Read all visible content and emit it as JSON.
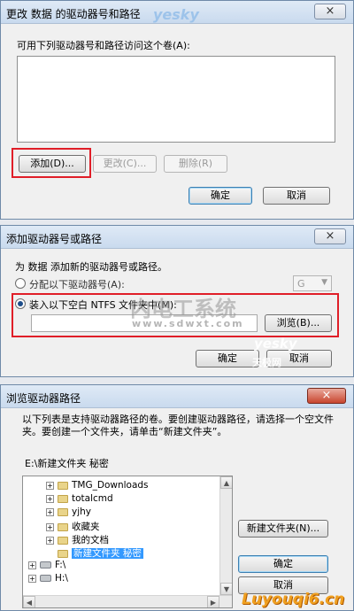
{
  "dialog1": {
    "title": "更改 数据 的驱动器号和路径",
    "close": "×",
    "list_label": "可用下列驱动器号和路径访问这个卷(A):",
    "add_button": "添加(D)...",
    "change_button": "更改(C)...",
    "delete_button": "删除(R)",
    "ok_button": "确定",
    "cancel_button": "取消"
  },
  "dialog2": {
    "title": "添加驱动器号或路径",
    "close": "×",
    "intro": "为 数据 添加新的驱动器号或路径。",
    "radio_letter_label": "分配以下驱动器号(A):",
    "letter_value": "G",
    "radio_folder_label": "装入以下空白 NTFS 文件夹中(M):",
    "folder_value": "",
    "browse_button": "浏览(B)...",
    "ok_button": "确定",
    "cancel_button": "取消"
  },
  "dialog3": {
    "title": "浏览驱动器路径",
    "close": "×",
    "description": "以下列表是支持驱动器路径的卷。要创建驱动器路径，请选择一个空文件夹。要创建一个文件夹，请单击“新建文件夹”。",
    "path_value": "E:\\新建文件夹 秘密",
    "tree": [
      {
        "label": "TMG_Downloads",
        "type": "folder",
        "expander": "+"
      },
      {
        "label": "totalcmd",
        "type": "folder",
        "expander": "+"
      },
      {
        "label": "yjhy",
        "type": "folder",
        "expander": "+"
      },
      {
        "label": "收藏夹",
        "type": "folder",
        "expander": "+"
      },
      {
        "label": "我的文档",
        "type": "folder",
        "expander": "+"
      },
      {
        "label": "新建文件夹 秘密",
        "type": "folder",
        "expander": "",
        "selected": true
      },
      {
        "label": "F:\\",
        "type": "drive",
        "expander": "+"
      },
      {
        "label": "H:\\",
        "type": "drive",
        "expander": "+"
      }
    ],
    "new_folder_button": "新建文件夹(N)...",
    "ok_button": "确定",
    "cancel_button": "取消"
  },
  "watermarks": {
    "yesky": "yesky",
    "neidian_cn": "内电工系统",
    "neidian_url": "www.sdwxt.com",
    "yesky2": "yesky",
    "tianji": "天极网",
    "luyouqi": "Luyouqi6.cn"
  },
  "colors": {
    "highlight": "#e01e28",
    "selection": "#3399ff"
  }
}
